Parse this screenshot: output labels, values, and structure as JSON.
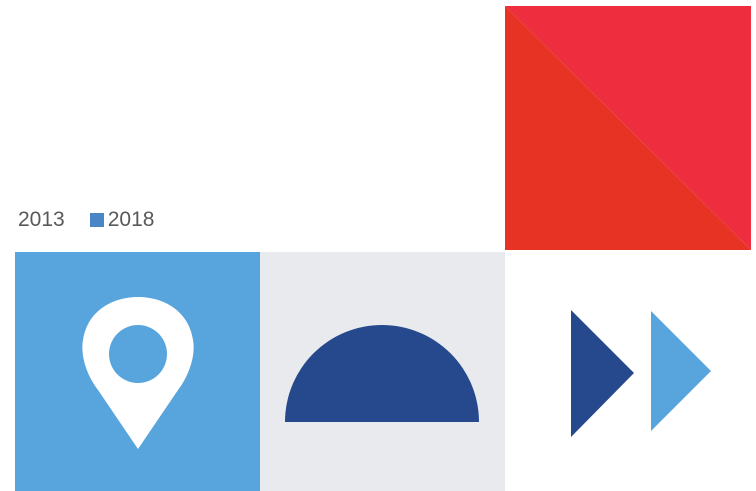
{
  "legend": {
    "items": [
      {
        "label": "2013",
        "color": "#ffffff"
      },
      {
        "label": "2018",
        "color": "#4a86c5"
      }
    ]
  },
  "colors": {
    "red_dark": "#e63324",
    "red_light": "#ee2e3f",
    "pin_background": "#58a4dd",
    "pin": "#ffffff",
    "dome_background": "#e9eaee",
    "dome": "#25498c",
    "arrow_dark": "#25498c",
    "arrow_light": "#58a4dd"
  },
  "icons": {
    "red_tile": "diagonal-split-square-icon",
    "pin_tile": "map-pin-icon",
    "dome_tile": "half-circle-icon",
    "arrows_tile": "fast-forward-icon"
  }
}
